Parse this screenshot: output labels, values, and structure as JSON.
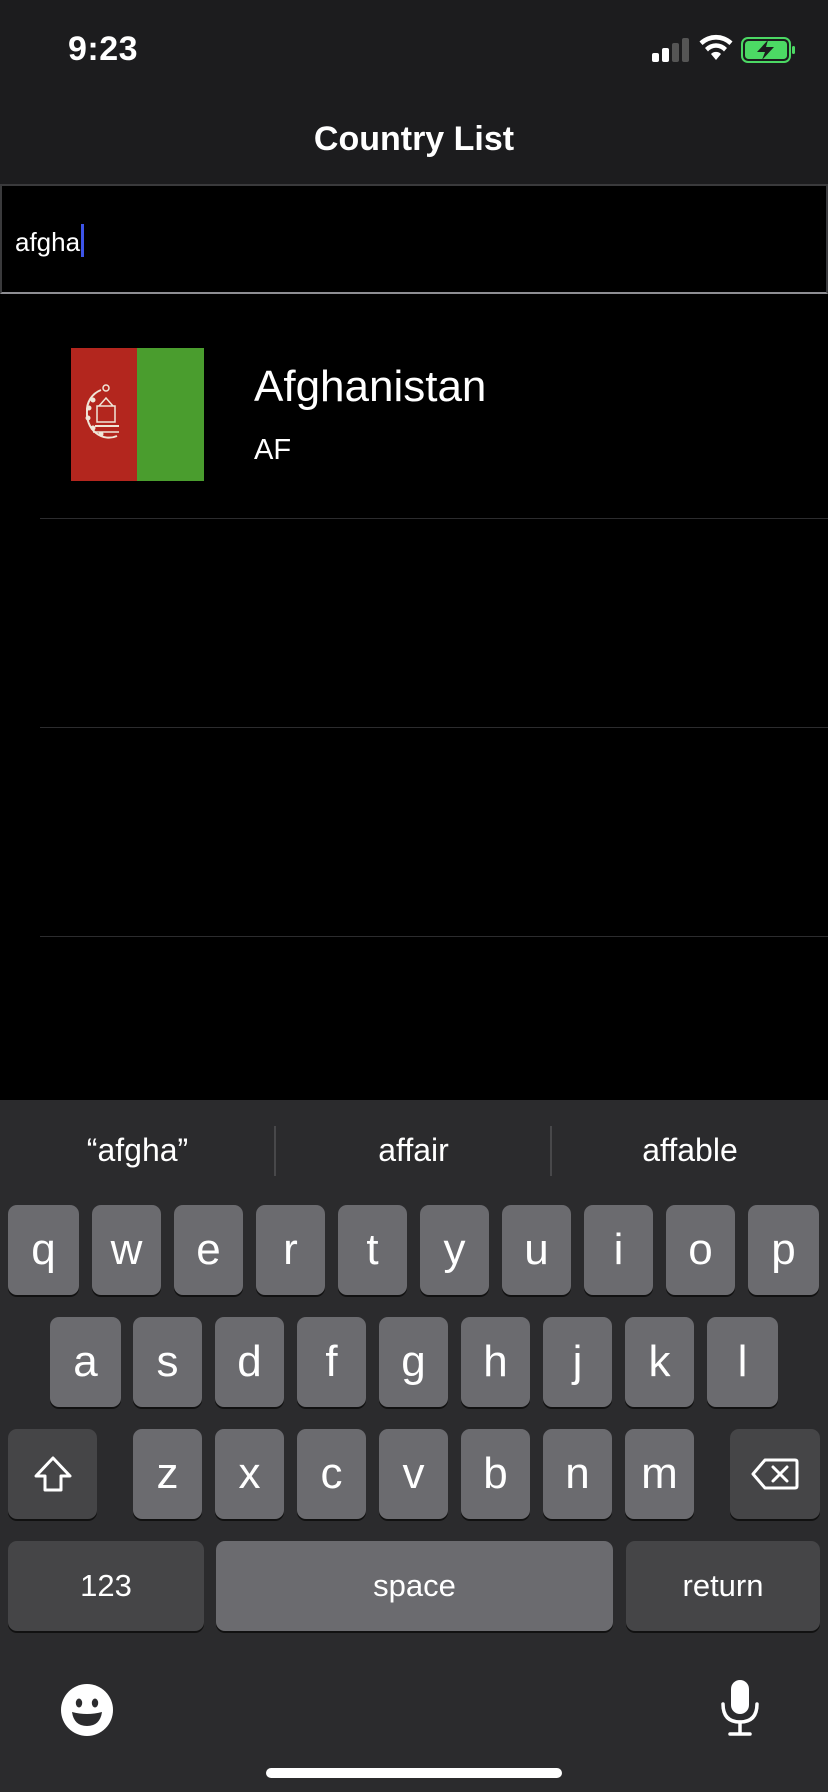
{
  "status_bar": {
    "time": "9:23",
    "icons": [
      "cellular-signal-icon",
      "wifi-icon",
      "battery-charging-icon"
    ],
    "battery_color": "#4cd964"
  },
  "nav": {
    "title": "Country List"
  },
  "search": {
    "value": "afgha",
    "caret_color": "#3d54e8"
  },
  "results": [
    {
      "name": "Afghanistan",
      "code": "AF",
      "flag": {
        "colors": [
          "#b3261e",
          "#4a9d2e"
        ],
        "emblem_icon": "afghanistan-emblem-icon"
      }
    }
  ],
  "keyboard": {
    "suggestions": [
      "“afgha”",
      "affair",
      "affable"
    ],
    "row1": [
      "q",
      "w",
      "e",
      "r",
      "t",
      "y",
      "u",
      "i",
      "o",
      "p"
    ],
    "row2": [
      "a",
      "s",
      "d",
      "f",
      "g",
      "h",
      "j",
      "k",
      "l"
    ],
    "row3": [
      "z",
      "x",
      "c",
      "v",
      "b",
      "n",
      "m"
    ],
    "shift_icon": "shift-icon",
    "delete_icon": "delete-backspace-icon",
    "numbers_label": "123",
    "space_label": "space",
    "return_label": "return",
    "emoji_icon": "emoji-icon",
    "mic_icon": "microphone-icon"
  }
}
